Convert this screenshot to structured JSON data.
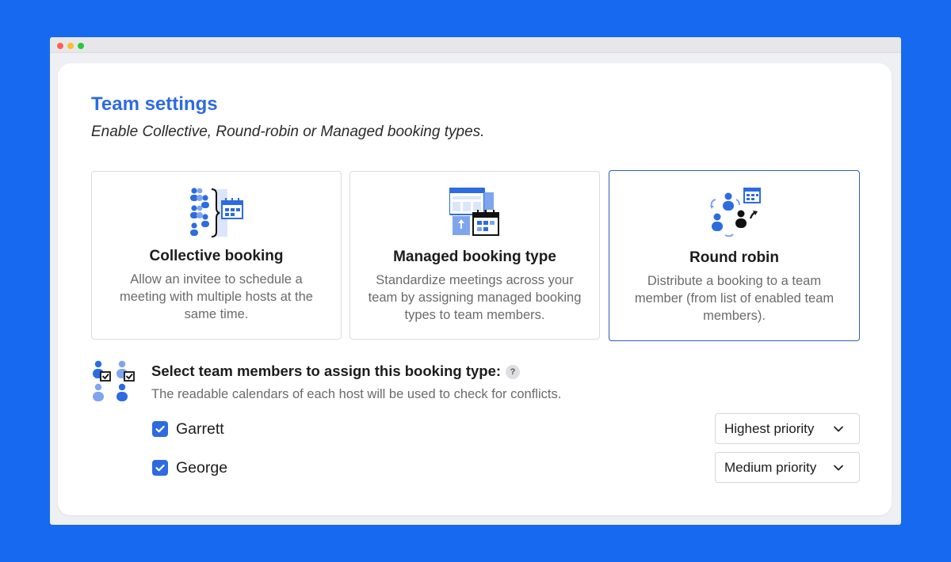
{
  "window": {
    "controls": [
      "close",
      "minimize",
      "maximize"
    ]
  },
  "page": {
    "title": "Team settings",
    "subtitle": "Enable Collective, Round-robin or Managed booking types."
  },
  "booking_types": [
    {
      "title": "Collective booking",
      "description": "Allow an invitee to schedule a meeting with multiple hosts at the same time.",
      "icon": "collective-booking-icon",
      "selected": false
    },
    {
      "title": "Managed booking type",
      "description": "Standardize meetings across your team by assigning managed booking types to team members.",
      "icon": "managed-booking-icon",
      "selected": false
    },
    {
      "title": "Round robin",
      "description": "Distribute a booking to a team member (from list of enabled team members).",
      "icon": "round-robin-icon",
      "selected": true
    }
  ],
  "assignment": {
    "title": "Select team members to assign this booking type:",
    "help_label": "?",
    "description": "The readable calendars of each host will be used to check for conflicts.",
    "icon": "team-members-icon"
  },
  "members": [
    {
      "name": "Garrett",
      "checked": true,
      "priority": "Highest priority"
    },
    {
      "name": "George",
      "checked": true,
      "priority": "Medium priority"
    }
  ],
  "colors": {
    "background": "#1769f0",
    "accent": "#2d6be0",
    "selected_border": "#2f5db6",
    "icon_light": "#7fa5ef",
    "icon_lighter": "#dbe6fb"
  }
}
